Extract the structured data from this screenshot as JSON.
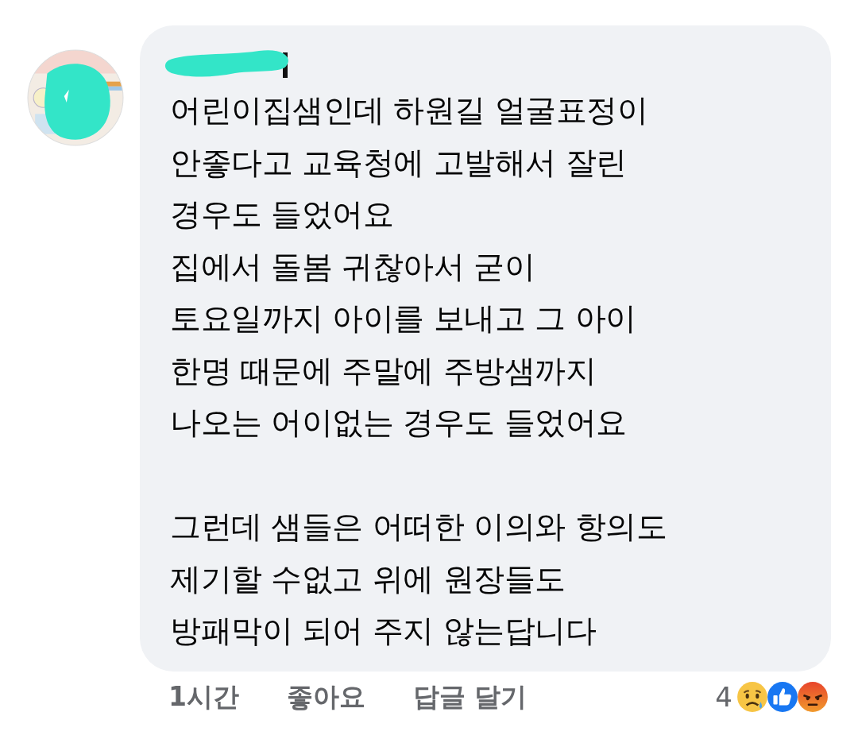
{
  "comment": {
    "text": "어린이집샘인데 하원길 얼굴표정이\n안좋다고 교육청에 고발해서 잘린\n경우도 들었어요\n집에서 돌봄 귀찮아서 굳이\n토요일까지 아이를 보내고 그 아이\n한명 때문에 주말에 주방샘까지\n나오는 어이없는 경우도 들었어요\n\n그런데 샘들은 어떠한 이의와 항의도\n제기할 수없고 위에 원장들도\n방패막이 되어 주지 않는답니다"
  },
  "actions": {
    "time": "1시간",
    "like": "좋아요",
    "reply": "답글 달기"
  },
  "reactions": {
    "count": "4",
    "items": [
      {
        "kind": "sad"
      },
      {
        "kind": "like"
      },
      {
        "kind": "angry"
      }
    ]
  }
}
